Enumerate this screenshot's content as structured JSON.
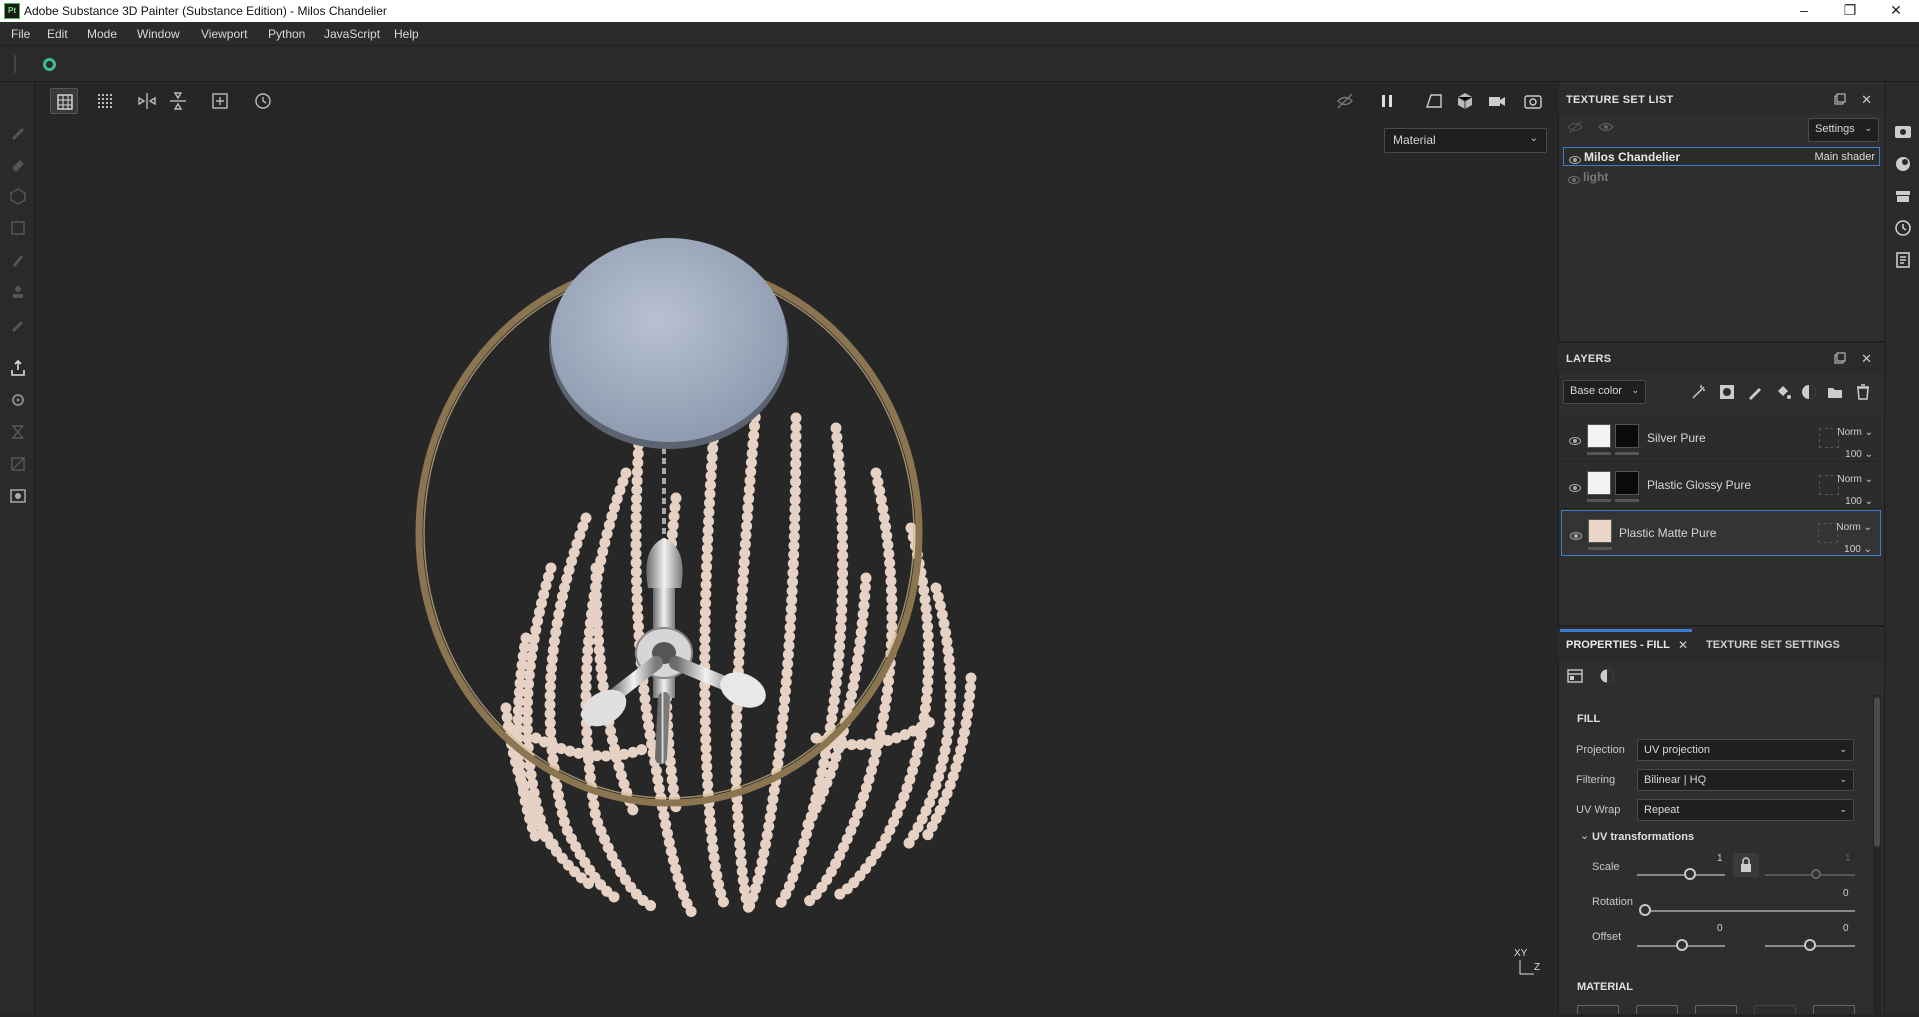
{
  "window": {
    "logo_text": "Pt",
    "title": "Adobe Substance 3D Painter (Substance Edition) - Milos Chandelier",
    "controls": [
      "minimize-icon",
      "maximize-icon",
      "close-icon"
    ]
  },
  "menu": {
    "items": [
      "File",
      "Edit",
      "Mode",
      "Window",
      "Viewport",
      "Python",
      "JavaScript",
      "Help"
    ]
  },
  "viewport": {
    "material_mode": "Material",
    "axis_label_xy": "XY",
    "axis_label_z": "Z"
  },
  "texture_set_list": {
    "title": "TEXTURE SET LIST",
    "settings_label": "Settings",
    "items": [
      {
        "name": "Milos Chandelier",
        "shader": "Main shader",
        "selected": true
      },
      {
        "name": "light",
        "shader": "",
        "selected": false
      }
    ]
  },
  "layers": {
    "title": "LAYERS",
    "channel": "Base color",
    "items": [
      {
        "name": "Silver Pure",
        "blend": "Norm",
        "opacity": "100",
        "selected": false
      },
      {
        "name": "Plastic Glossy Pure",
        "blend": "Norm",
        "opacity": "100",
        "selected": false
      },
      {
        "name": "Plastic Matte Pure",
        "blend": "Norm",
        "opacity": "100",
        "selected": true
      }
    ]
  },
  "properties": {
    "tab_fill": "PROPERTIES - FILL",
    "tab_texture_set": "TEXTURE SET SETTINGS",
    "section_fill": "FILL",
    "projection_label": "Projection",
    "projection_value": "UV projection",
    "filtering_label": "Filtering",
    "filtering_value": "Bilinear | HQ",
    "uvwrap_label": "UV Wrap",
    "uvwrap_value": "Repeat",
    "uv_transformations": "UV transformations",
    "scale_label": "Scale",
    "scale_value": "1",
    "scale_value_locked": "1",
    "rotation_label": "Rotation",
    "rotation_value": "0",
    "offset_label": "Offset",
    "offset_u": "0",
    "offset_v": "0",
    "section_material": "MATERIAL"
  },
  "colors": {
    "accent_blue": "#3d7ccf",
    "sync_green": "#3fbf8f",
    "bead_color": "#e8d3c6",
    "ring_color": "#8a7550",
    "canopy_color": "#a4b1c6"
  }
}
